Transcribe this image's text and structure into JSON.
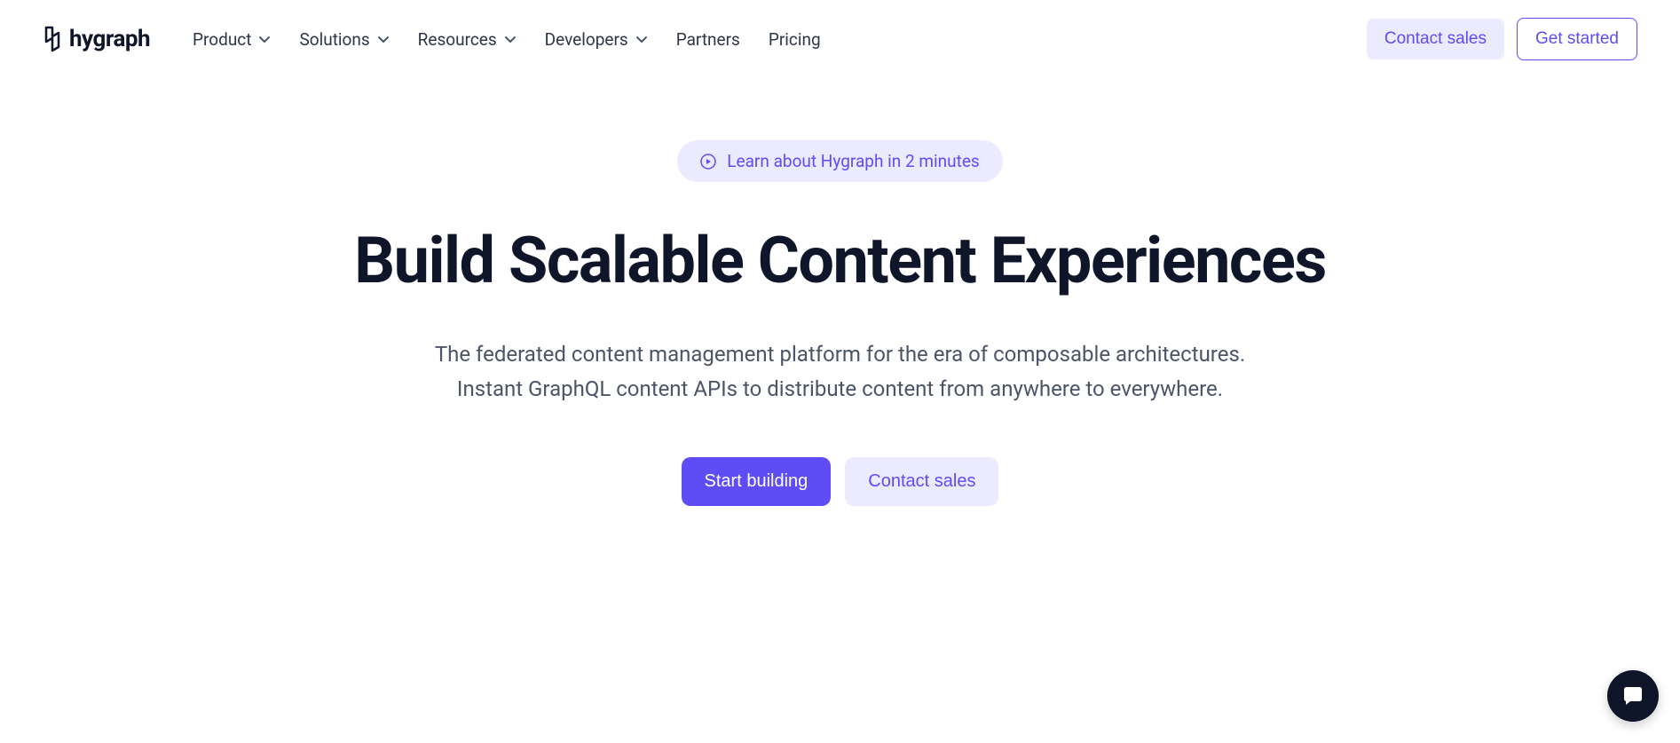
{
  "brand": {
    "name": "hygraph"
  },
  "nav": {
    "items": [
      {
        "label": "Product",
        "hasDropdown": true
      },
      {
        "label": "Solutions",
        "hasDropdown": true
      },
      {
        "label": "Resources",
        "hasDropdown": true
      },
      {
        "label": "Developers",
        "hasDropdown": true
      },
      {
        "label": "Partners",
        "hasDropdown": false
      },
      {
        "label": "Pricing",
        "hasDropdown": false
      }
    ]
  },
  "header_actions": {
    "contact_sales": "Contact sales",
    "get_started": "Get started"
  },
  "hero": {
    "pill_label": "Learn about Hygraph in 2 minutes",
    "headline": "Build Scalable Content Experiences",
    "subheadline": "The federated content management platform for the era of composable architectures. Instant GraphQL content APIs to distribute content from anywhere to everywhere.",
    "cta_primary": "Start building",
    "cta_secondary": "Contact sales"
  },
  "colors": {
    "primary": "#5e4cf5",
    "primary_light": "#ebeaff",
    "text_dark": "#0f1629",
    "text_muted": "#4a5568"
  }
}
